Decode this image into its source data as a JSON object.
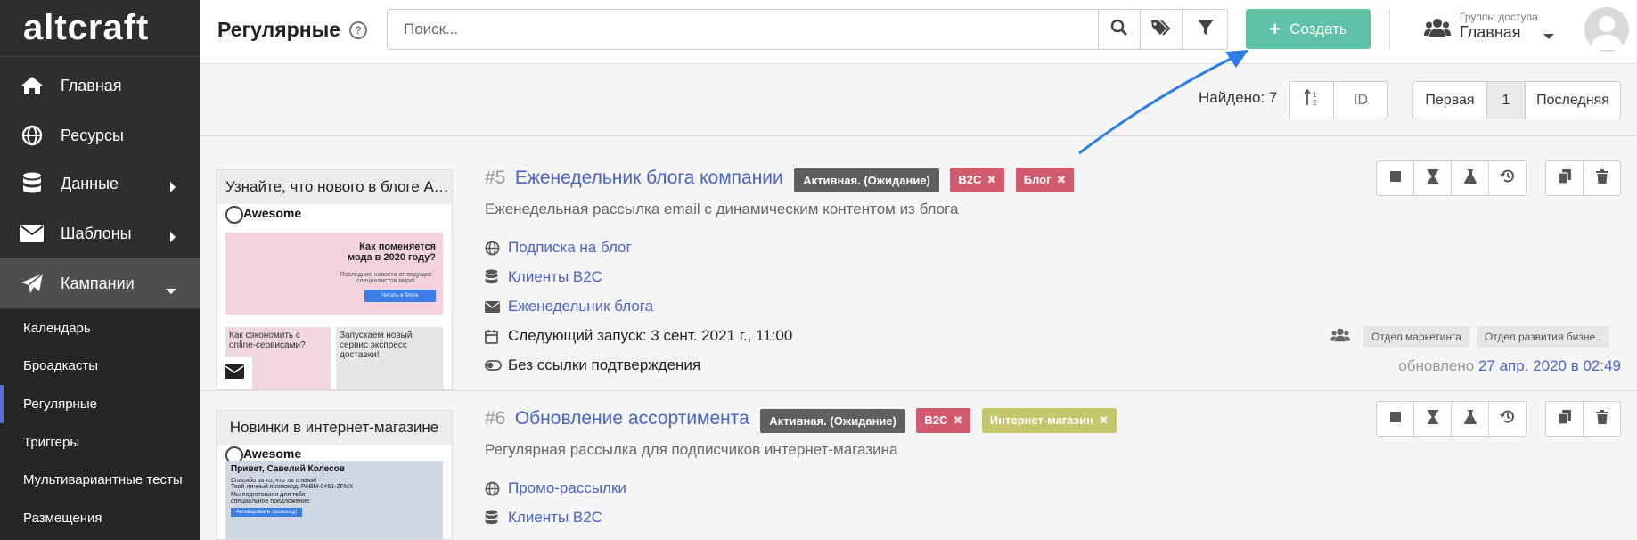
{
  "app": {
    "logo": "altcraft"
  },
  "sidebar": {
    "main_items": [
      {
        "label": "Главная",
        "icon": "home-icon"
      },
      {
        "label": "Ресурсы",
        "icon": "globe-icon"
      },
      {
        "label": "Данные",
        "icon": "database-icon"
      },
      {
        "label": "Шаблоны",
        "icon": "envelope-icon"
      },
      {
        "label": "Кампании",
        "icon": "paper-plane-icon"
      }
    ],
    "sub_items": [
      {
        "label": "Календарь"
      },
      {
        "label": "Броадкасты"
      },
      {
        "label": "Регулярные"
      },
      {
        "label": "Триггеры"
      },
      {
        "label": "Мультивариантные тесты"
      },
      {
        "label": "Размещения"
      }
    ]
  },
  "header": {
    "title": "Регулярные",
    "help_glyph": "?",
    "search_placeholder": "Поиск...",
    "create_label": "Создать",
    "access_group_label": "Группы доступа",
    "access_group_value": "Главная"
  },
  "list_controls": {
    "found_label": "Найдено: 7",
    "sort_field": "ID",
    "pager": {
      "first": "Первая",
      "current": "1",
      "last": "Последняя"
    }
  },
  "colors": {
    "accent": "#5fc2a5",
    "link": "#4a64c4",
    "tag_b2c": "#d05a6e",
    "tag_blog": "#d05a6e",
    "tag_shop": "#c5c86a",
    "status": "#5f5f5f"
  },
  "campaigns": [
    {
      "id": "#5",
      "title": "Еженедельник блога компании",
      "status": "Активная. (Ожидание)",
      "tags": [
        {
          "label": "B2C",
          "x": "✖"
        },
        {
          "label": "Блог",
          "x": "✖"
        }
      ],
      "description": "Еженедельная рассылка email с динамическим контентом из блога",
      "thumb_title": "Узнайте, что нового в блоге Awesome",
      "thumb_brand": "Awesome",
      "thumb_banner": "Как поменяется мода в 2020 году?",
      "thumb_banner_sub": "Последние новости от ведущих специалистов мира!",
      "thumb_banner_btn": "Читать в блоге",
      "thumb_left": "Как сэкономить с online-сервисами?",
      "thumb_right": "Запускаем новый сервис экспресс доставки!",
      "resource": "Подписка на блог",
      "database": "Клиенты B2C",
      "template": "Еженедельник блога",
      "next_run": "Следующий запуск: 3 сент. 2021 г., 11:00",
      "confirmation": "Без ссылки подтверждения",
      "groups": [
        "Отдел маркетинга",
        "Отдел развития бизне.."
      ],
      "updated_prefix": "обновлено",
      "updated_at": "27 апр. 2020 в 02:49"
    },
    {
      "id": "#6",
      "title": "Обновление ассортимента",
      "status": "Активная. (Ожидание)",
      "tags": [
        {
          "label": "B2C",
          "x": "✖"
        },
        {
          "label": "Интернет-магазин",
          "x": "✖"
        }
      ],
      "description": "Регулярная рассылка для подписчиков интернет-магазина",
      "thumb_title": "Новинки в интернет-магазине",
      "thumb_brand": "Awesome",
      "thumb_greeting": "Привет, Савелий Колесов",
      "thumb_line1": "Спасибо за то, что ты с нами!",
      "thumb_line2": "Твой личный промокод: PABM-0461-ZFMX",
      "thumb_line3": "Мы подготовили для тебя специальное предложение:",
      "thumb_btn": "Активировать промокод!",
      "resource": "Промо-рассылки",
      "database": "Клиенты B2C"
    }
  ]
}
